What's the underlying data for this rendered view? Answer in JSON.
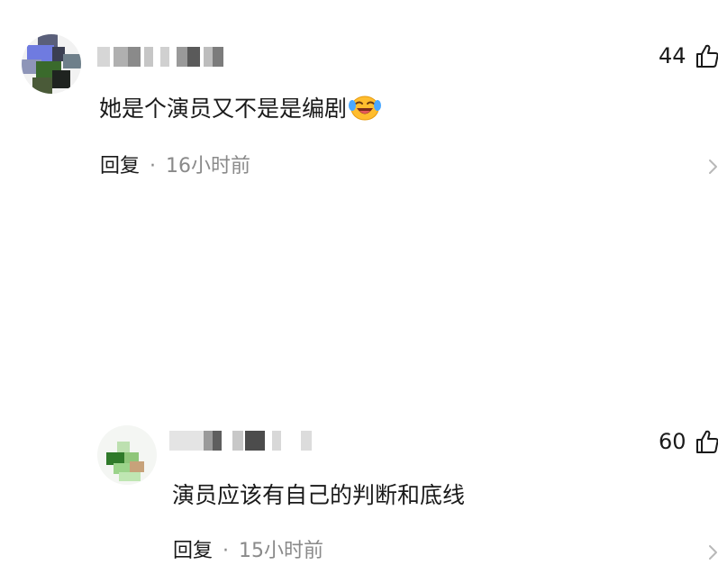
{
  "comments": [
    {
      "text": "她是个演员又不是是编剧",
      "emoji": "laughing-crying-emoji",
      "reply_label": "回复",
      "separator": "·",
      "time": "16小时前",
      "likes": "44"
    },
    {
      "text": "演员应该有自己的判断和底线",
      "reply_label": "回复",
      "separator": "·",
      "time": "15小时前",
      "likes": "60"
    }
  ],
  "colors": {
    "text": "#1a1a1a",
    "muted": "#8a8a8a",
    "background": "#ffffff"
  }
}
